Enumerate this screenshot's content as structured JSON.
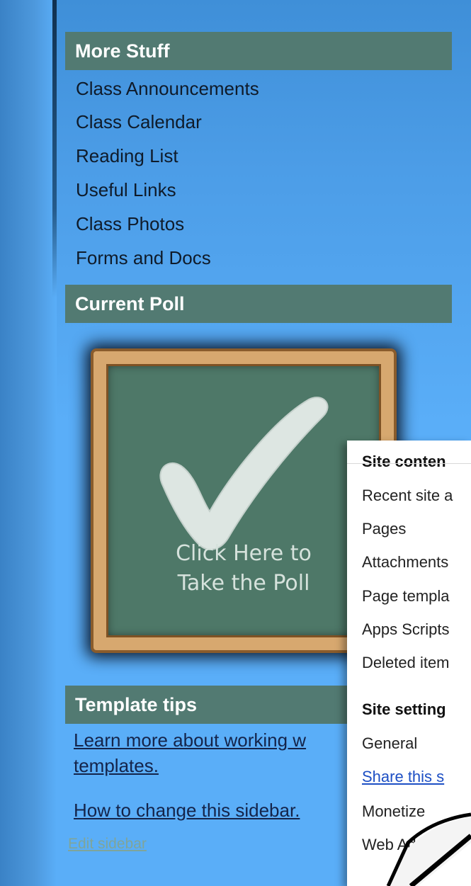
{
  "sidebar": {
    "more_stuff": {
      "title": "More Stuff",
      "links": [
        "Class Announcements",
        "Class Calendar",
        "Reading List",
        "Useful Links",
        "Class Photos",
        "Forms and Docs"
      ]
    },
    "current_poll": {
      "title": "Current Poll",
      "poll_line1": "Click Here to",
      "poll_line2": "Take the Poll"
    },
    "template_tips": {
      "title": "Template tips",
      "learn_line1": "Learn more about working w",
      "learn_line2": "templates.",
      "change_sidebar": "How to change this sidebar."
    },
    "edit_sidebar": "Edit sidebar"
  },
  "menu": {
    "site_content_header": "Site conten",
    "content_items": [
      "Recent site a",
      "Pages",
      "Attachments",
      "Page templa",
      "Apps Scripts",
      "Deleted item"
    ],
    "site_settings_header": "Site setting",
    "settings_items": [
      "General",
      "Share this s",
      "Monetize",
      "Web Ad"
    ]
  },
  "colors": {
    "background": "#5aaef8",
    "section_header": "#527a72",
    "chalkboard": "#4e7868",
    "frame": "#d7a86f",
    "menu_link": "#1d4fc4"
  }
}
